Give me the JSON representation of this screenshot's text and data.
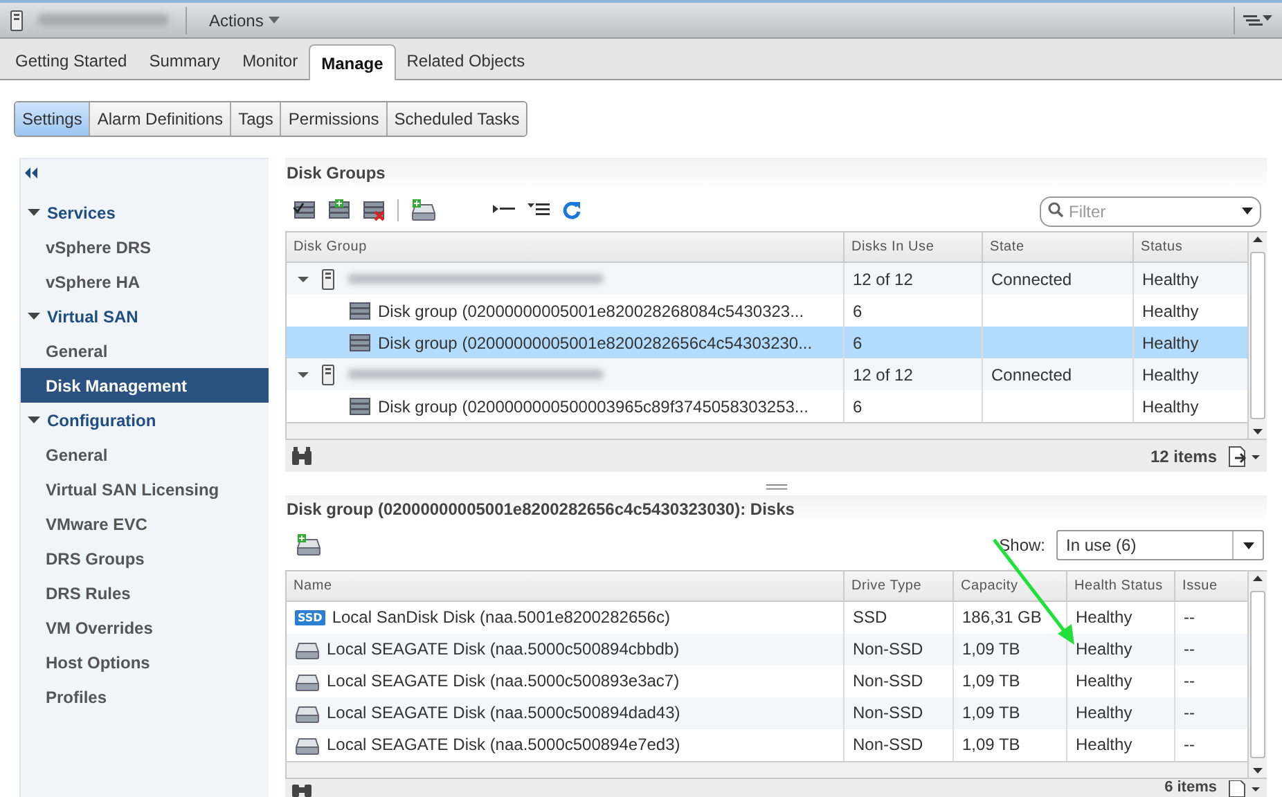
{
  "header": {
    "actions_label": "Actions"
  },
  "tabs": [
    {
      "label": "Getting Started",
      "selected": false
    },
    {
      "label": "Summary",
      "selected": false
    },
    {
      "label": "Monitor",
      "selected": false
    },
    {
      "label": "Manage",
      "selected": true
    },
    {
      "label": "Related Objects",
      "selected": false
    }
  ],
  "subtabs": [
    {
      "label": "Settings",
      "selected": true
    },
    {
      "label": "Alarm Definitions",
      "selected": false
    },
    {
      "label": "Tags",
      "selected": false
    },
    {
      "label": "Permissions",
      "selected": false
    },
    {
      "label": "Scheduled Tasks",
      "selected": false
    }
  ],
  "sidebar": {
    "sections": [
      {
        "label": "Services",
        "expanded": true,
        "items": [
          {
            "label": "vSphere DRS",
            "selected": false
          },
          {
            "label": "vSphere HA",
            "selected": false
          }
        ]
      },
      {
        "label": "Virtual SAN",
        "expanded": true,
        "items": [
          {
            "label": "General",
            "selected": false
          },
          {
            "label": "Disk Management",
            "selected": true
          }
        ]
      },
      {
        "label": "Configuration",
        "expanded": true,
        "items": [
          {
            "label": "General",
            "selected": false
          },
          {
            "label": "Virtual SAN Licensing",
            "selected": false
          },
          {
            "label": "VMware EVC",
            "selected": false
          },
          {
            "label": "DRS Groups",
            "selected": false
          },
          {
            "label": "DRS Rules",
            "selected": false
          },
          {
            "label": "VM Overrides",
            "selected": false
          },
          {
            "label": "Host Options",
            "selected": false
          },
          {
            "label": "Profiles",
            "selected": false
          }
        ]
      }
    ]
  },
  "disk_groups": {
    "title": "Disk Groups",
    "filter": {
      "placeholder": "Filter"
    },
    "columns": [
      "Disk Group",
      "Disks In Use",
      "State",
      "Status"
    ],
    "hosts": [
      {
        "expanded": true,
        "selected": false,
        "disks_in_use": "12 of 12",
        "state": "Connected",
        "status": "Healthy",
        "children": [
          {
            "name": "Disk group (02000000005001e820028268084c5430323...",
            "disks_in_use": "6",
            "status": "Healthy",
            "selected": false
          },
          {
            "name": "Disk group (02000000005001e8200282656c4c54303230...",
            "disks_in_use": "6",
            "status": "Healthy",
            "selected": true
          }
        ]
      },
      {
        "expanded": true,
        "selected": false,
        "disks_in_use": "12 of 12",
        "state": "Connected",
        "status": "Healthy",
        "children": [
          {
            "name": "Disk group (0200000000500003965c89f3745058303253...",
            "disks_in_use": "6",
            "status": "Healthy",
            "selected": false
          }
        ]
      }
    ],
    "item_count": "12 items"
  },
  "disks": {
    "title": "Disk group (02000000005001e8200282656c4c5430323030): Disks",
    "show_label": "Show:",
    "show_value": "In use (6)",
    "columns": [
      "Name",
      "Drive Type",
      "Capacity",
      "Health Status",
      "Issue"
    ],
    "rows": [
      {
        "kind": "ssd",
        "badge": "SSD",
        "name": "Local SanDisk Disk (naa.5001e8200282656c)",
        "drive_type": "SSD",
        "capacity": "186,31 GB",
        "health": "Healthy",
        "issue": "--"
      },
      {
        "kind": "hdd",
        "name": "Local SEAGATE Disk (naa.5000c500894cbbdb)",
        "drive_type": "Non-SSD",
        "capacity": "1,09 TB",
        "health": "Healthy",
        "issue": "--"
      },
      {
        "kind": "hdd",
        "name": "Local SEAGATE Disk (naa.5000c500893e3ac7)",
        "drive_type": "Non-SSD",
        "capacity": "1,09 TB",
        "health": "Healthy",
        "issue": "--"
      },
      {
        "kind": "hdd",
        "name": "Local SEAGATE Disk (naa.5000c500894dad43)",
        "drive_type": "Non-SSD",
        "capacity": "1,09 TB",
        "health": "Healthy",
        "issue": "--"
      },
      {
        "kind": "hdd",
        "name": "Local SEAGATE Disk (naa.5000c500894e7ed3)",
        "drive_type": "Non-SSD",
        "capacity": "1,09 TB",
        "health": "Healthy",
        "issue": "--"
      }
    ],
    "item_count": "6 items"
  }
}
